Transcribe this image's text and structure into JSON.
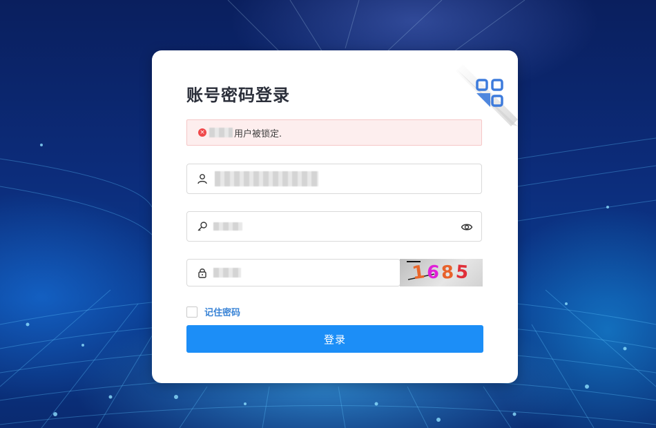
{
  "login": {
    "title": "账号密码登录",
    "alert": {
      "icon": "error-icon",
      "message": "用户被锁定.",
      "color": "#f0484a"
    },
    "username": {
      "value": "",
      "icon": "user-icon"
    },
    "password": {
      "value": "",
      "icon": "key-icon",
      "toggle_icon": "eye-icon"
    },
    "captcha": {
      "input_value": "",
      "icon": "lock-icon",
      "image_text": "1685"
    },
    "remember_label": "记住密码",
    "remember_checked": false,
    "submit_label": "登录",
    "accent_color": "#1c8ef7",
    "qr_switch_icon": "qr-code-icon"
  }
}
